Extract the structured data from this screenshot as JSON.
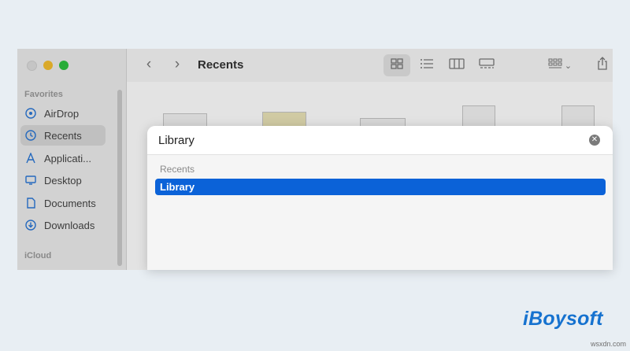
{
  "window": {
    "title": "Recents",
    "back_glyph": "‹",
    "forward_glyph": "›",
    "view_buttons": [
      "icon-view-icon",
      "list-view-icon",
      "column-view-icon",
      "gallery-view-icon"
    ],
    "group_caret": "⌄",
    "share_glyph": "⇧"
  },
  "sidebar": {
    "favorites_label": "Favorites",
    "icloud_label": "iCloud",
    "items": [
      {
        "label": "AirDrop",
        "icon": "airdrop-icon"
      },
      {
        "label": "Recents",
        "icon": "clock-icon"
      },
      {
        "label": "Applicati...",
        "icon": "applications-icon"
      },
      {
        "label": "Desktop",
        "icon": "desktop-icon"
      },
      {
        "label": "Documents",
        "icon": "document-icon"
      },
      {
        "label": "Downloads",
        "icon": "download-icon"
      }
    ]
  },
  "search_dialog": {
    "query": "Library",
    "clear_glyph": "✕",
    "section_label": "Recents",
    "results": [
      {
        "label": "Library",
        "selected": true
      }
    ]
  },
  "branding": {
    "logo": "iBoysoft",
    "watermark": "wsxdn.com"
  },
  "colors": {
    "accent": "#0b62d8",
    "logo": "#1672cf",
    "traffic_min": "#f5be2f",
    "traffic_max": "#2dc23f"
  }
}
